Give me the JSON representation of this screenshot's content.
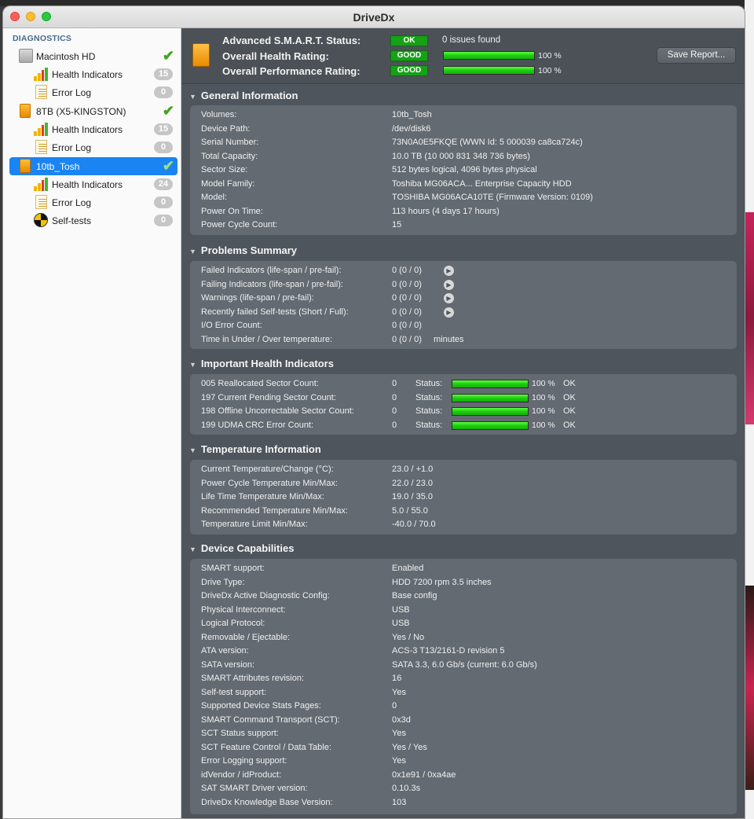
{
  "window": {
    "title": "DriveDx"
  },
  "sidebar": {
    "header": "DIAGNOSTICS",
    "items": [
      {
        "label": "Macintosh HD",
        "icon": "hdd-icon",
        "check": true
      },
      {
        "label": "Health Indicators",
        "icon": "health-bars-icon",
        "count": "15"
      },
      {
        "label": "Error Log",
        "icon": "error-log-icon",
        "count": "0"
      },
      {
        "label": "8TB (X5-KINGSTON)",
        "icon": "usb-drive-icon",
        "check": true
      },
      {
        "label": "Health Indicators",
        "icon": "health-bars-icon",
        "count": "15"
      },
      {
        "label": "Error Log",
        "icon": "error-log-icon",
        "count": "0"
      },
      {
        "label": "10tb_Tosh",
        "icon": "usb-drive-icon",
        "check": true,
        "selected": true
      },
      {
        "label": "Health Indicators",
        "icon": "health-bars-icon",
        "count": "24"
      },
      {
        "label": "Error Log",
        "icon": "error-log-icon",
        "count": "0"
      },
      {
        "label": "Self-tests",
        "icon": "self-test-icon",
        "count": "0"
      }
    ]
  },
  "status": {
    "smart_label": "Advanced S.M.A.R.T. Status:",
    "smart_badge": "OK",
    "smart_issues": "0 issues found",
    "health_label": "Overall Health Rating:",
    "health_badge": "GOOD",
    "health_pct": "100 %",
    "health_fraction": 1.0,
    "perf_label": "Overall Performance Rating:",
    "perf_badge": "GOOD",
    "perf_pct": "100 %",
    "perf_fraction": 1.0,
    "save_button": "Save Report...",
    "colors": {
      "ok_green": "#16a116",
      "bar_green": "#2ed81a"
    }
  },
  "general": {
    "title": "General Information",
    "rows": [
      {
        "label": "Volumes:",
        "value": "10tb_Tosh"
      },
      {
        "label": "Device Path:",
        "value": "/dev/disk6"
      },
      {
        "label": "Serial Number:",
        "value": "73N0A0E5FKQE (WWN Id: 5 000039 ca8ca724c)"
      },
      {
        "label": "Total Capacity:",
        "value": "10.0 TB (10 000 831 348 736 bytes)"
      },
      {
        "label": "Sector Size:",
        "value": "512 bytes logical, 4096 bytes physical"
      },
      {
        "label": "Model Family:",
        "value": "Toshiba MG06ACA... Enterprise Capacity HDD"
      },
      {
        "label": "Model:",
        "value": "TOSHIBA MG06ACA10TE  (Firmware Version: 0109)"
      },
      {
        "label": "Power On Time:",
        "value": "113 hours (4 days 17 hours)"
      },
      {
        "label": "Power Cycle Count:",
        "value": "15"
      }
    ]
  },
  "problems": {
    "title": "Problems Summary",
    "rows": [
      {
        "label": "Failed Indicators (life-span / pre-fail):",
        "value": "0  (0 / 0)",
        "arrow": true
      },
      {
        "label": "Failing Indicators (life-span / pre-fail):",
        "value": "0  (0 / 0)",
        "arrow": true
      },
      {
        "label": "Warnings (life-span / pre-fail):",
        "value": "0  (0 / 0)",
        "arrow": true
      },
      {
        "label": "Recently failed Self-tests (Short / Full):",
        "value": "0  (0 / 0)",
        "arrow": true
      },
      {
        "label": "I/O Error Count:",
        "value": "0  (0 / 0)",
        "arrow": false
      },
      {
        "label": "Time in Under / Over temperature:",
        "value": "0  (0 / 0)",
        "arrow": false,
        "suffix": "minutes"
      }
    ]
  },
  "health": {
    "title": "Important Health Indicators",
    "status_label": "Status:",
    "rows": [
      {
        "label": "005  Reallocated Sector Count:",
        "value": "0",
        "pct": "100 %",
        "fraction": 1.0,
        "ok": "OK"
      },
      {
        "label": "197  Current Pending Sector Count:",
        "value": "0",
        "pct": "100 %",
        "fraction": 1.0,
        "ok": "OK"
      },
      {
        "label": "198  Offline Uncorrectable Sector Count:",
        "value": "0",
        "pct": "100 %",
        "fraction": 1.0,
        "ok": "OK"
      },
      {
        "label": "199  UDMA CRC Error Count:",
        "value": "0",
        "pct": "100 %",
        "fraction": 1.0,
        "ok": "OK"
      }
    ]
  },
  "temperature": {
    "title": "Temperature Information",
    "rows": [
      {
        "label": "Current Temperature/Change (°C):",
        "value": "23.0   / +1.0"
      },
      {
        "label": "Power Cycle Temperature Min/Max:",
        "value": "22.0   / 23.0"
      },
      {
        "label": "Life Time Temperature Min/Max:",
        "value": "19.0   / 35.0"
      },
      {
        "label": "Recommended Temperature Min/Max:",
        "value": "5.0     / 55.0"
      },
      {
        "label": "Temperature Limit Min/Max:",
        "value": "-40.0 / 70.0"
      }
    ]
  },
  "capabilities": {
    "title": "Device Capabilities",
    "rows": [
      {
        "label": "SMART support:",
        "value": "Enabled"
      },
      {
        "label": "Drive Type:",
        "value": "HDD 7200 rpm 3.5 inches"
      },
      {
        "label": "DriveDx Active Diagnostic Config:",
        "value": "Base config"
      },
      {
        "label": "Physical Interconnect:",
        "value": "USB"
      },
      {
        "label": "Logical Protocol:",
        "value": "USB"
      },
      {
        "label": "Removable / Ejectable:",
        "value": "Yes / No"
      },
      {
        "label": "ATA version:",
        "value": "ACS-3 T13/2161-D revision 5"
      },
      {
        "label": "SATA version:",
        "value": "SATA 3.3, 6.0 Gb/s (current: 6.0 Gb/s)"
      },
      {
        "label": "SMART Attributes revision:",
        "value": "16"
      },
      {
        "label": "Self-test support:",
        "value": "Yes"
      },
      {
        "label": "Supported Device Stats Pages:",
        "value": "0"
      },
      {
        "label": "SMART Command Transport (SCT):",
        "value": "0x3d"
      },
      {
        "label": "SCT Status support:",
        "value": "Yes"
      },
      {
        "label": "SCT Feature Control / Data Table:",
        "value": "Yes / Yes"
      },
      {
        "label": "Error Logging support:",
        "value": "Yes"
      },
      {
        "label": "idVendor / idProduct:",
        "value": "0x1e91 / 0xa4ae"
      },
      {
        "label": "SAT SMART Driver version:",
        "value": "0.10.3s"
      },
      {
        "label": "DriveDx Knowledge Base Version:",
        "value": "103"
      }
    ]
  }
}
